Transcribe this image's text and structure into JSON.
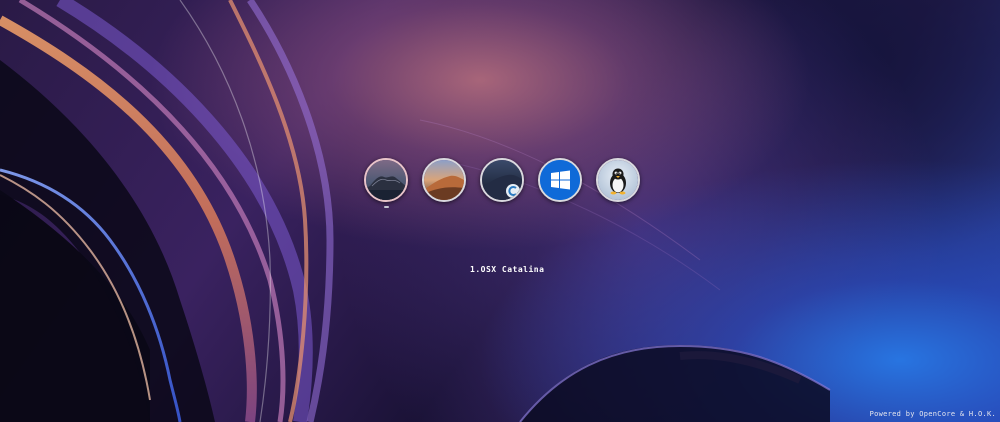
{
  "boot_entries": [
    {
      "name": "macos-catalina",
      "icon": "catalina-island-icon",
      "selected": true
    },
    {
      "name": "macos-mojave",
      "icon": "mojave-dunes-icon",
      "selected": false
    },
    {
      "name": "macos-recovery",
      "icon": "recovery-icon",
      "selected": false
    },
    {
      "name": "windows",
      "icon": "windows-logo-icon",
      "selected": false
    },
    {
      "name": "linux",
      "icon": "tux-penguin-icon",
      "selected": false
    }
  ],
  "selected_label": "1.OSX Catalina",
  "footer_text": "Powered by OpenCore & H.O.K.",
  "colors": {
    "windows_blue": "#0f6ad8",
    "linux_bg": "#c6d6e6",
    "label_text": "#ffffff"
  }
}
